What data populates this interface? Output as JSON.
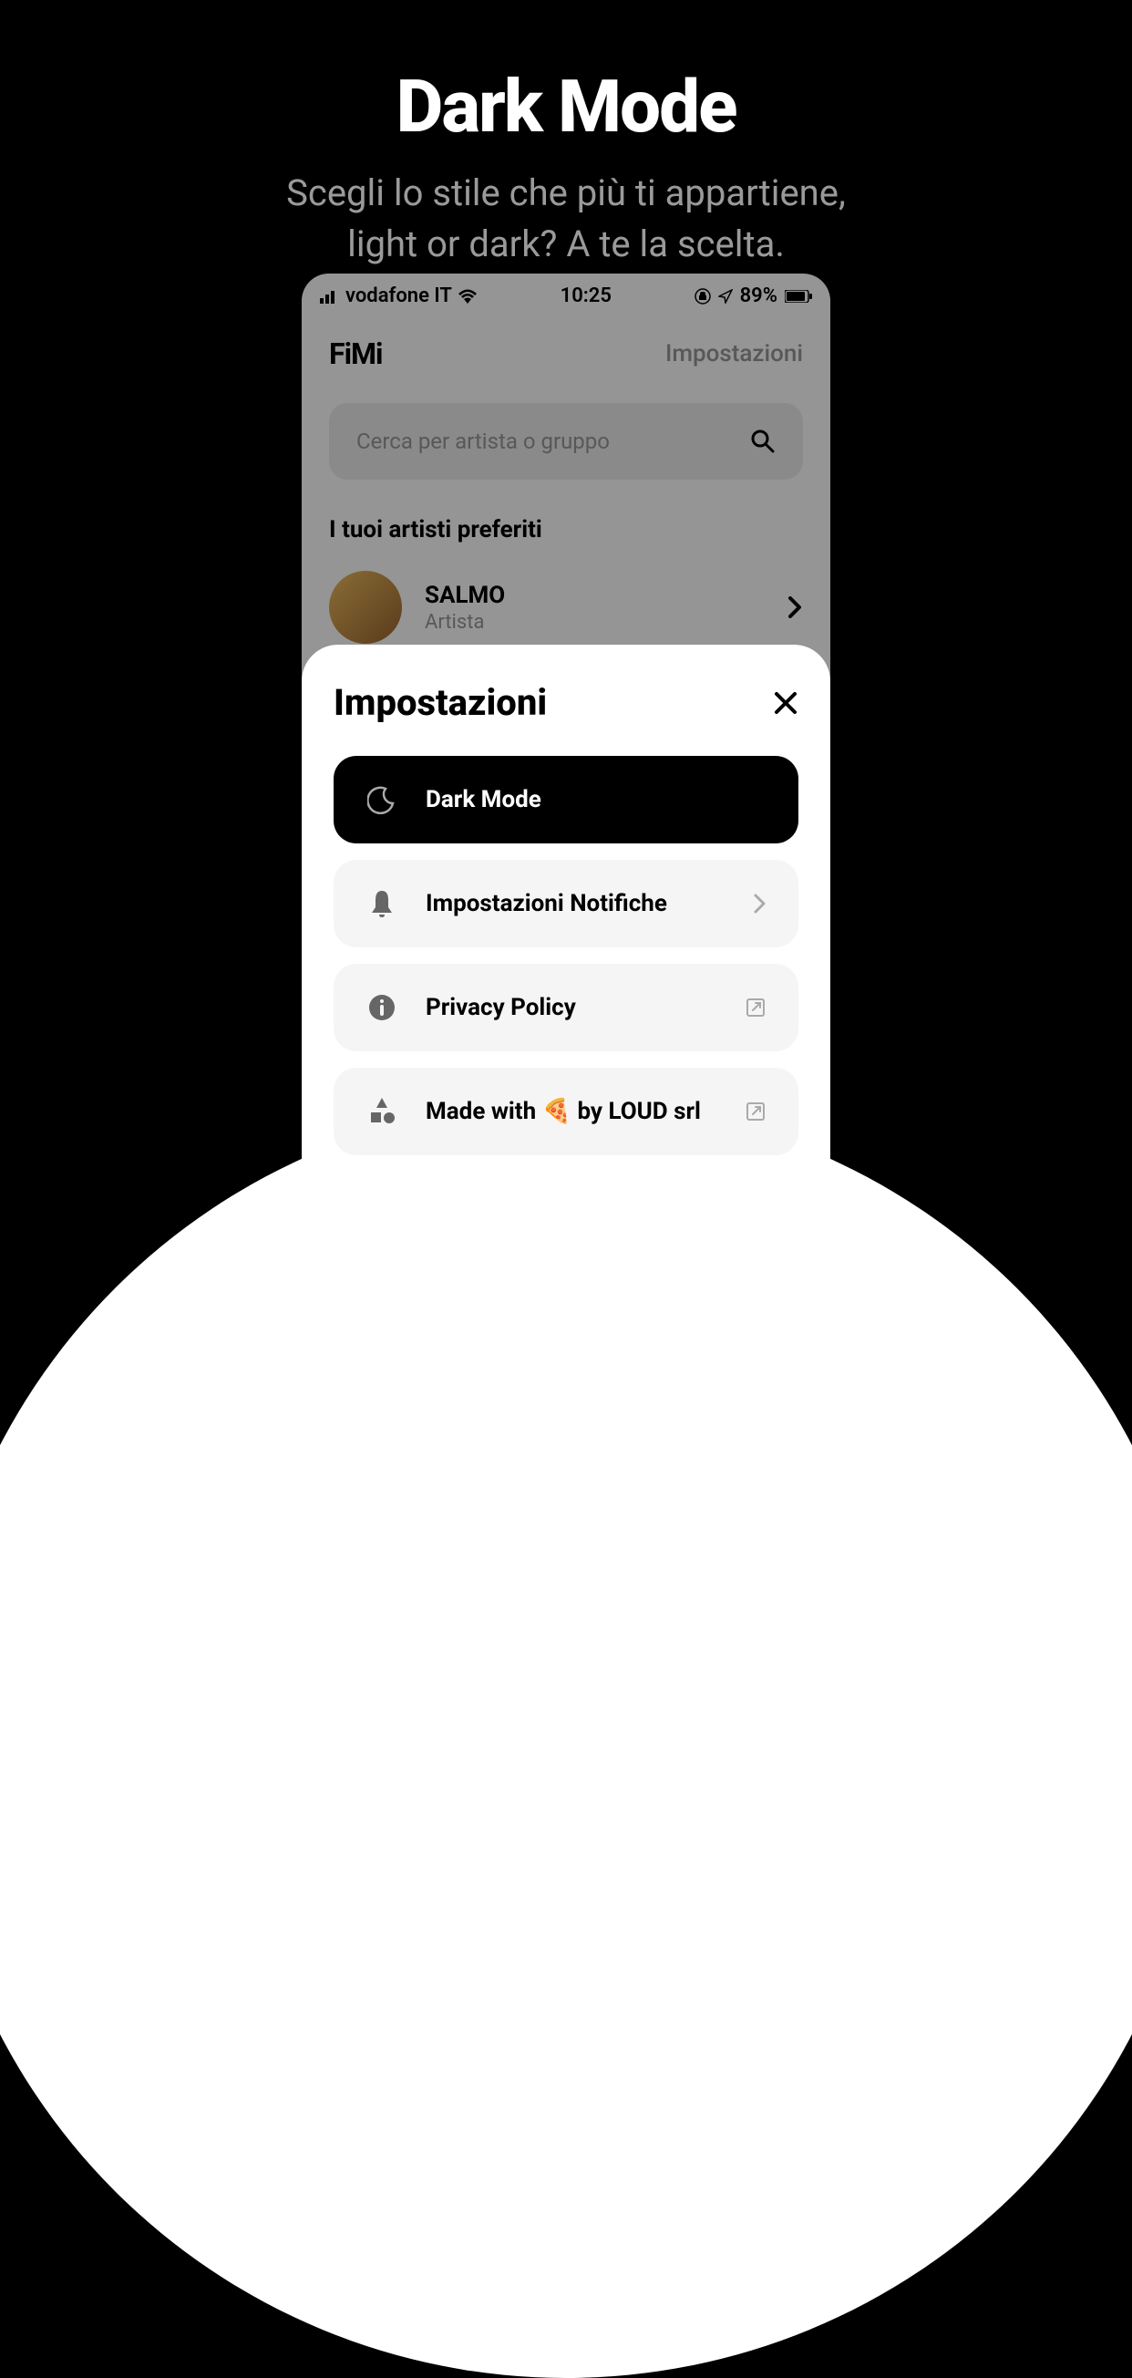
{
  "promo": {
    "title": "Dark Mode",
    "subtitle_line1": "Scegli lo stile che più ti appartiene,",
    "subtitle_line2": "light or dark? A te la scelta."
  },
  "status_bar": {
    "carrier": "vodafone IT",
    "time": "10:25",
    "battery": "89%"
  },
  "app": {
    "logo": "FiMi",
    "settings_link": "Impostazioni",
    "search_placeholder": "Cerca per artista o gruppo",
    "favorites_title": "I tuoi artisti preferiti"
  },
  "artist": {
    "name": "SALMO",
    "type": "Artista"
  },
  "sheet": {
    "title": "Impostazioni",
    "items": [
      {
        "label": "Dark Mode"
      },
      {
        "label": "Impostazioni Notifiche"
      },
      {
        "label": "Privacy Policy"
      },
      {
        "label": "Made with 🍕 by LOUD srl"
      }
    ]
  }
}
